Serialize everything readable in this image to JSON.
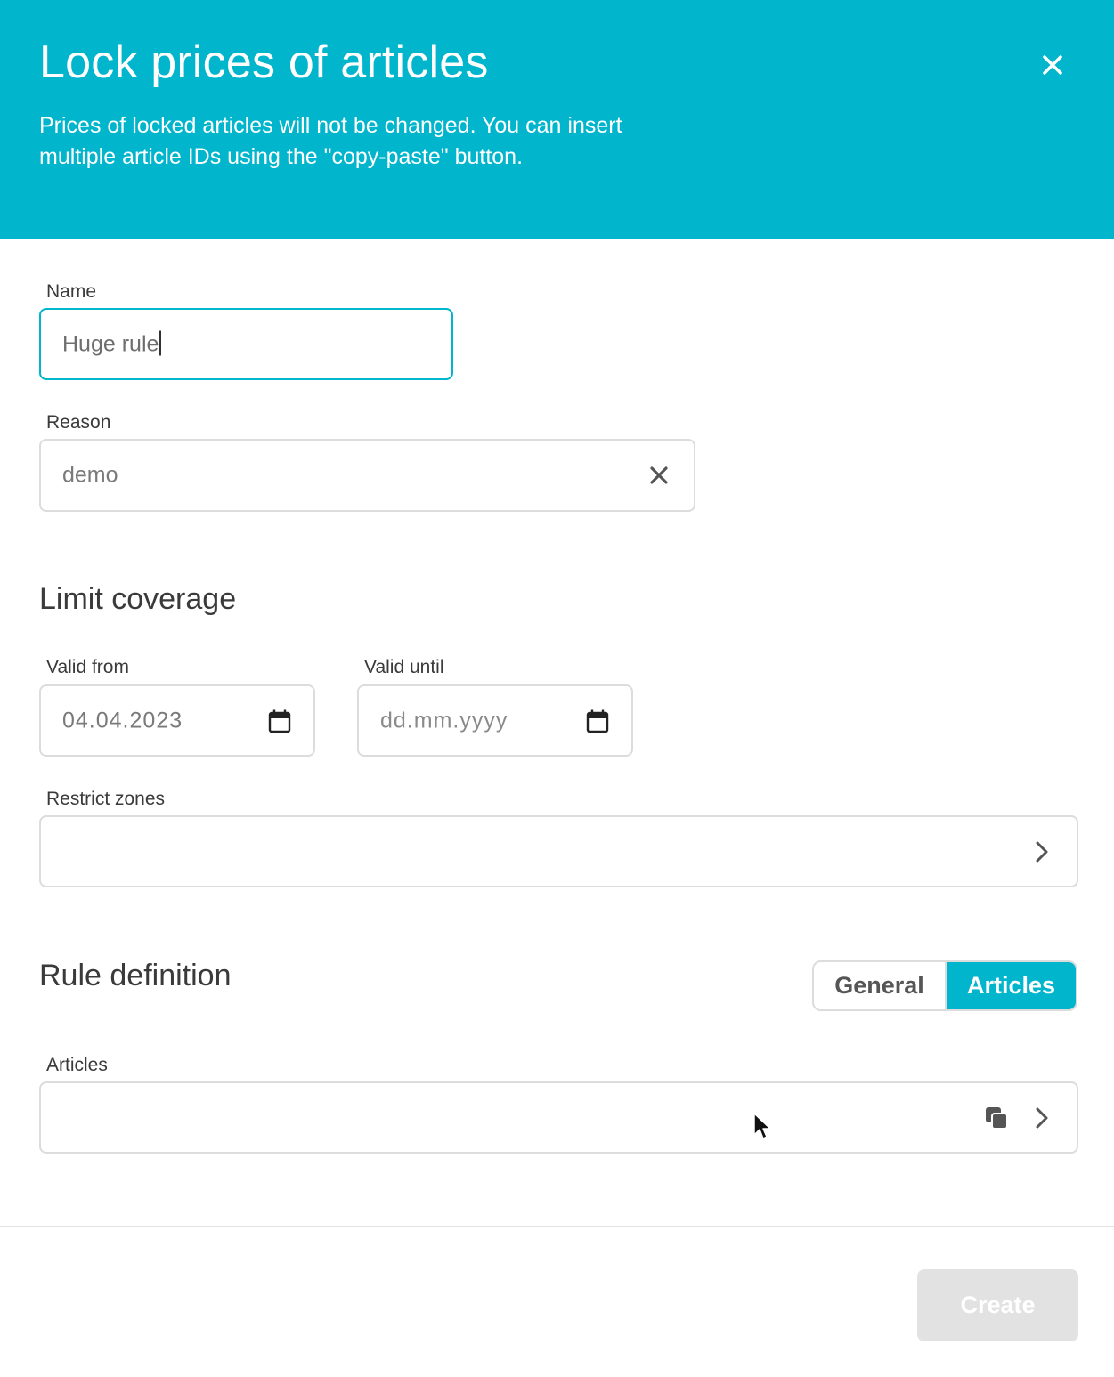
{
  "dialog": {
    "title": "Lock prices of articles",
    "description": "Prices of locked articles will not be changed. You can insert multiple article IDs using the \"copy-paste\" button.",
    "close_icon": "close-icon"
  },
  "form": {
    "name": {
      "label": "Name",
      "value": "Huge rule"
    },
    "reason": {
      "label": "Reason",
      "value": "demo",
      "clear_icon": "clear-icon"
    },
    "limit_coverage": {
      "title": "Limit coverage",
      "valid_from": {
        "label": "Valid from",
        "value": "04.04.2023",
        "icon": "calendar-icon"
      },
      "valid_until": {
        "label": "Valid until",
        "placeholder": "dd.mm.yyyy",
        "icon": "calendar-icon"
      },
      "restrict_zones": {
        "label": "Restrict zones",
        "value": "",
        "icon": "chevron-right-icon"
      }
    },
    "rule_definition": {
      "title": "Rule definition",
      "tabs": [
        {
          "label": "General",
          "active": false
        },
        {
          "label": "Articles",
          "active": true
        }
      ],
      "articles": {
        "label": "Articles",
        "value": "",
        "icons": [
          "copy-paste-icon",
          "chevron-right-icon"
        ]
      }
    }
  },
  "footer": {
    "create_label": "Create",
    "create_disabled": true
  },
  "colors": {
    "accent": "#00b5cc",
    "border": "#dcdcdc",
    "disabled": "#e2e2e2",
    "text": "#3a3a3a"
  }
}
